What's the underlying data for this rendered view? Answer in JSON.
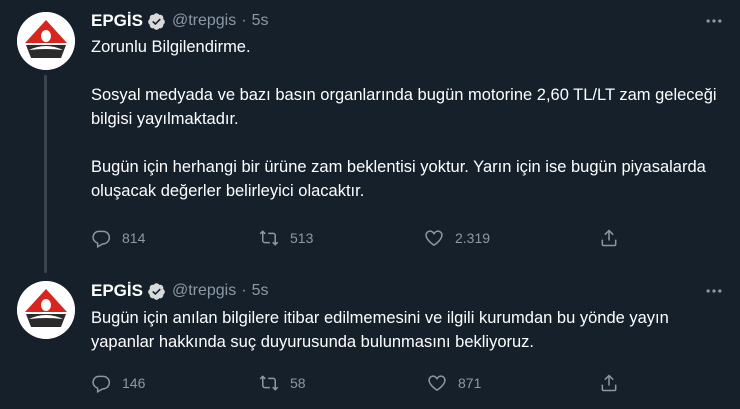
{
  "tweets": [
    {
      "author": "EPGİS",
      "handle": "@trepgis",
      "separator": "·",
      "time": "5s",
      "text": "Zorunlu Bilgilendirme.\n\nSosyal medyada ve bazı basın organlarında bugün motorine 2,60 TL/LT zam geleceği bilgisi yayılmaktadır.\n\nBugün için herhangi bir ürüne zam beklentisi yoktur. Yarın için ise bugün piyasalarda oluşacak değerler belirleyici olacaktır.",
      "replies": "814",
      "retweets": "513",
      "likes": "2.319"
    },
    {
      "author": "EPGİS",
      "handle": "@trepgis",
      "separator": "·",
      "time": "5s",
      "text": "Bugün için anılan bilgilere itibar edilmemesini ve ilgili kurumdan bu yönde yayın yapanlar hakkında suç duyurusunda bulunmasını bekliyoruz.",
      "replies": "146",
      "retweets": "58",
      "likes": "871"
    }
  ],
  "colors": {
    "background": "#15202b",
    "secondary_text": "#8b98a5",
    "verified": "#1d9bf0",
    "logo_red": "#d7261e",
    "thread_line": "#38444d"
  },
  "icons": [
    "epgis-logo",
    "verified-badge-icon",
    "more-icon",
    "reply-icon",
    "retweet-icon",
    "like-icon",
    "share-icon"
  ]
}
